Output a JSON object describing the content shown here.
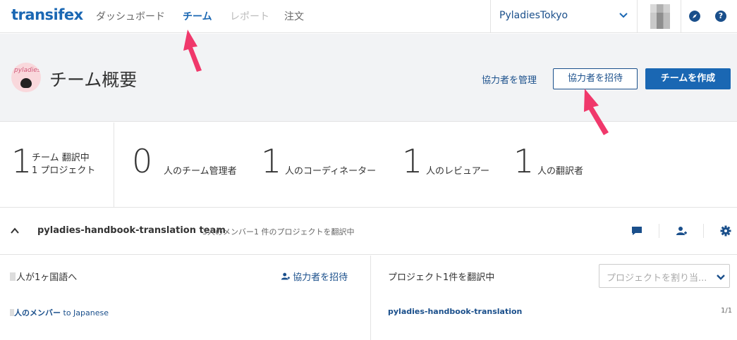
{
  "topbar": {
    "logo": "transifex",
    "nav": [
      {
        "label": "ダッシュボード",
        "state": "normal"
      },
      {
        "label": "チーム",
        "state": "active"
      },
      {
        "label": "レポート",
        "state": "disabled"
      },
      {
        "label": "注文",
        "state": "normal"
      }
    ],
    "team_selector": "PyladiesTokyo",
    "icons": {
      "explore": "compass-icon",
      "help": "help-icon",
      "help_glyph": "?"
    }
  },
  "header": {
    "team_logo_text": "pyladies",
    "title": "チーム概要",
    "manage_link": "協力者を管理",
    "invite_button": "協力者を招待",
    "create_button": "チームを作成"
  },
  "stats": {
    "projects": {
      "value": "1",
      "line1": "チーム 翻訳中",
      "line2": "1 プロジェクト"
    },
    "managers": {
      "value": "0",
      "label": "人のチーム管理者"
    },
    "coordinators": {
      "value": "1",
      "label": "人のコーディネーター"
    },
    "reviewers": {
      "value": "1",
      "label": "人のレビュアー"
    },
    "translators": {
      "value": "1",
      "label": "人の翻訳者"
    }
  },
  "team": {
    "name": "pyladies-handbook-translation team",
    "meta": "3人のメンバー1 件のプロジェクトを翻訳中"
  },
  "languages_panel": {
    "title": "人が1ヶ国語へ",
    "invite_link": "協力者を招待",
    "members_label": "人のメンバー",
    "members_target": "to Japanese"
  },
  "projects_panel": {
    "title": "プロジェクト1件を翻訳中",
    "select_placeholder": "プロジェクトを割り当...",
    "project_name": "pyladies-handbook-translation",
    "project_count": "1/1"
  },
  "colors": {
    "brand": "#1a67b3",
    "link": "#1a4f8b",
    "annotation": "#f0386b"
  }
}
